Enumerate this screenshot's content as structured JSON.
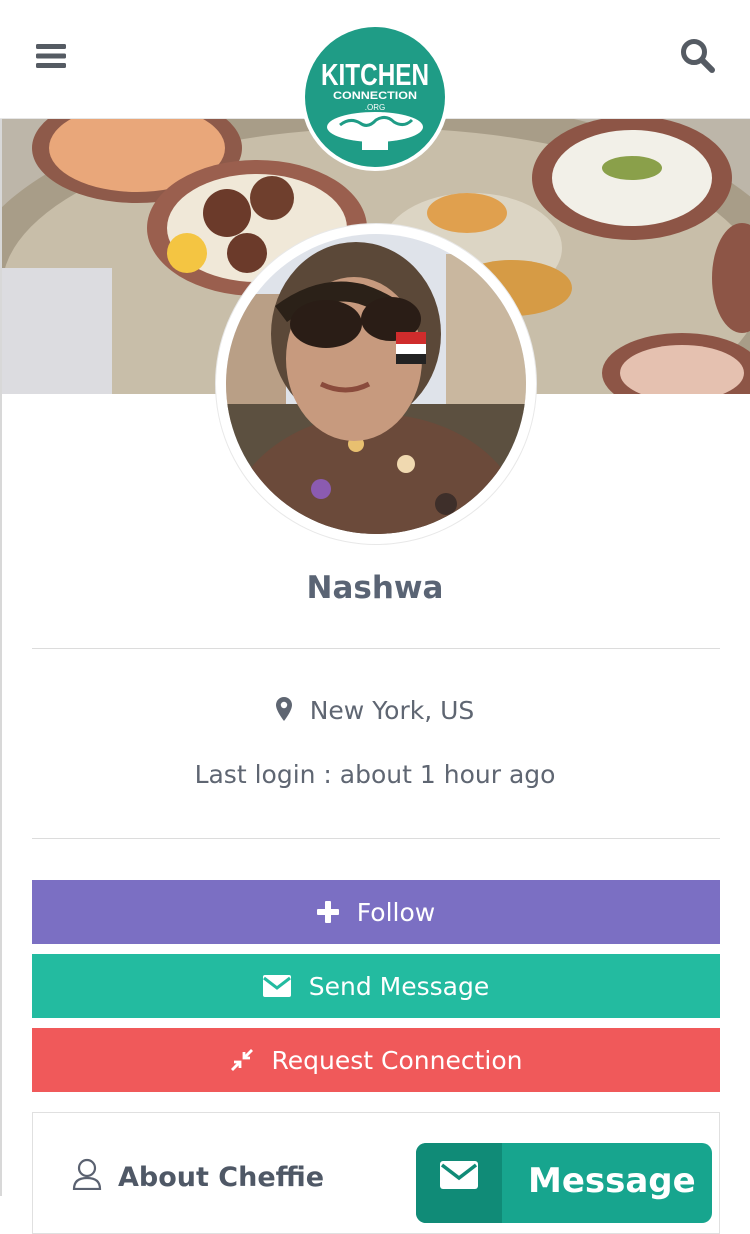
{
  "header": {
    "menu_icon": "hamburger-menu-icon",
    "search_icon": "search-icon",
    "logo": {
      "line1": "KITCHEN",
      "line2": "CONNECTION",
      "line3": ".ORG",
      "color": "#1f9c86"
    }
  },
  "profile": {
    "name": "Nashwa",
    "location": "New York, US",
    "last_login": "Last login : about 1 hour ago"
  },
  "actions": {
    "follow": {
      "label": "Follow",
      "icon": "plus-icon",
      "color": "#7b6fc3"
    },
    "send_message": {
      "label": "Send Message",
      "icon": "envelope-icon",
      "color": "#23bba0"
    },
    "request_connection": {
      "label": "Request Connection",
      "icon": "compress-arrows-icon",
      "color": "#f0595a"
    }
  },
  "about": {
    "title": "About Cheffie",
    "icon": "user-icon"
  },
  "floating_message": {
    "label": "Message",
    "icon": "envelope-icon",
    "color": "#17a58e"
  }
}
